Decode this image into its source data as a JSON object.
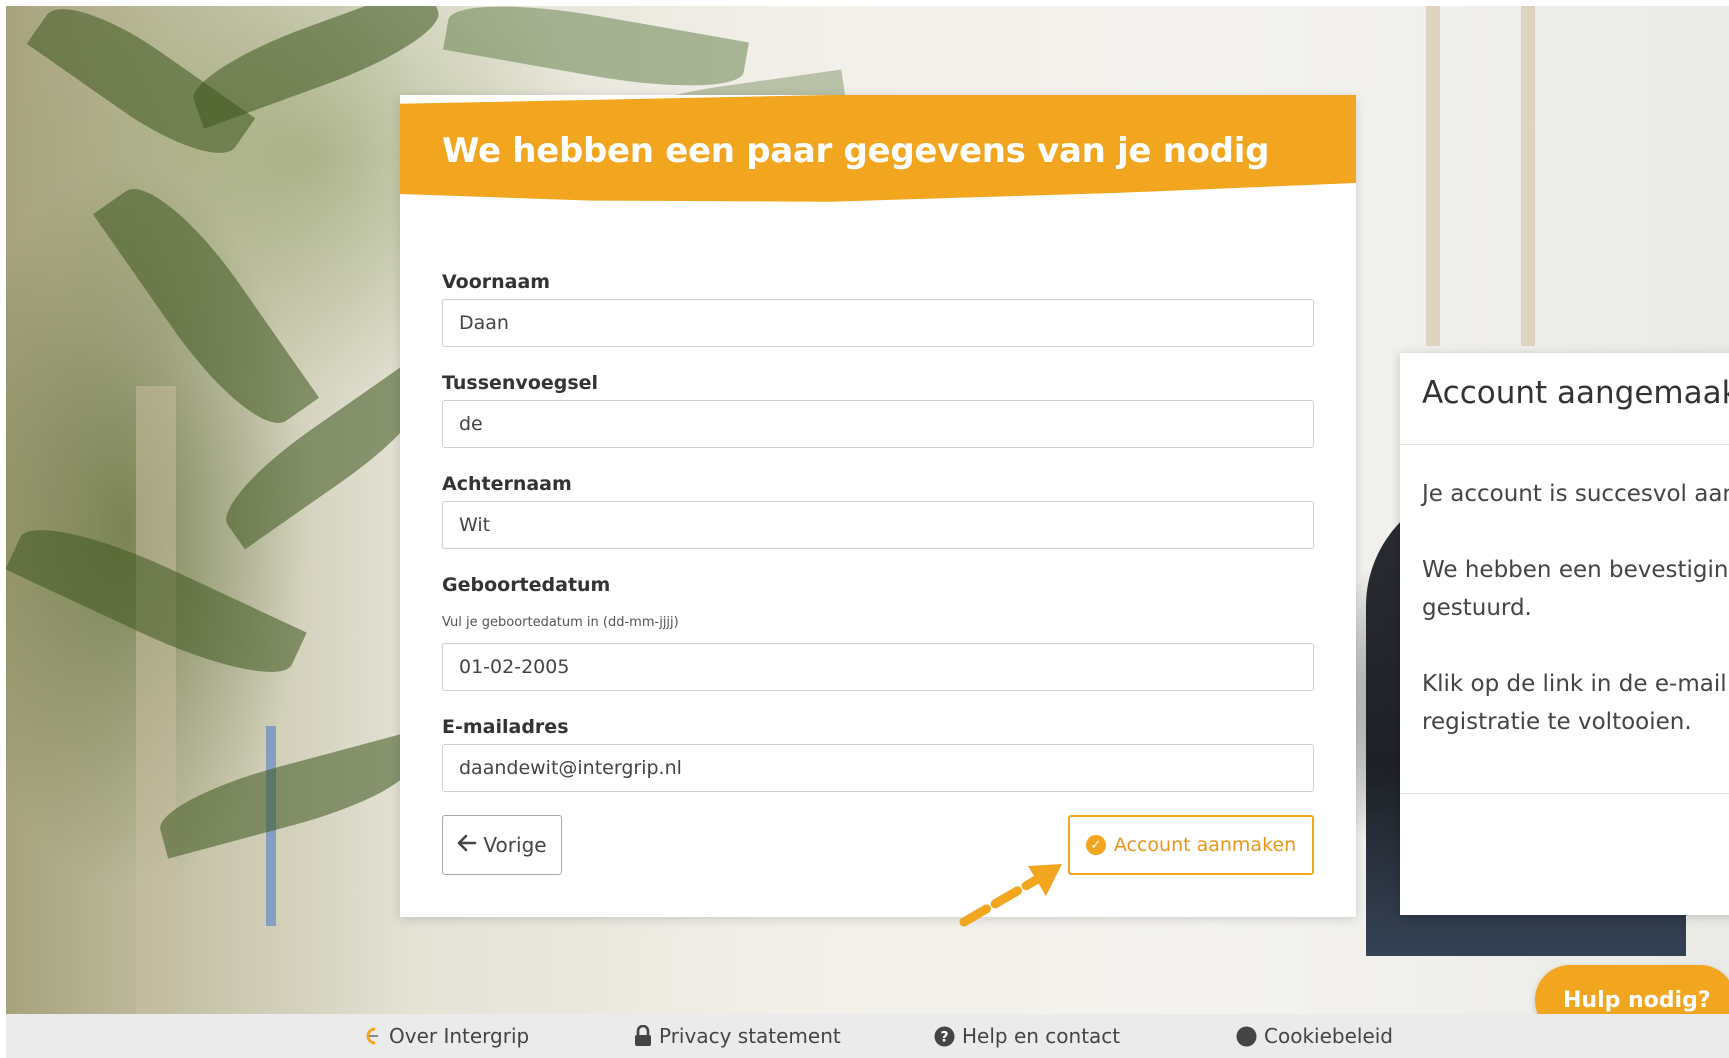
{
  "form": {
    "title": "We hebben een paar gegevens van je nodig",
    "fields": [
      {
        "label": "Voornaam",
        "value": "Daan"
      },
      {
        "label": "Tussenvoegsel",
        "value": "de"
      },
      {
        "label": "Achternaam",
        "value": "Wit"
      },
      {
        "label": "Geboortedatum",
        "hint": "Vul je geboortedatum in (dd-mm-jjjj)",
        "value": "01-02-2005"
      },
      {
        "label": "E-mailadres",
        "value": "daandewit@intergrip.nl"
      }
    ],
    "prev_button": "Vorige",
    "create_button": "Account aanmaken"
  },
  "modal": {
    "title": "Account aangemaakt",
    "line1": "Je account is succesvol aan",
    "line2a": "We hebben een bevestigin",
    "line2b": "gestuurd.",
    "line3a": "Klik op de link in de e-mail",
    "line3b": "registratie te voltooien."
  },
  "help_button": "Hulp nodig?",
  "footer": {
    "links": [
      {
        "label": "Over Intergrip",
        "icon": "intergrip-logo-icon"
      },
      {
        "label": "Privacy statement",
        "icon": "lock-icon"
      },
      {
        "label": "Help en contact",
        "icon": "question-circle-icon"
      },
      {
        "label": "Cookiebeleid",
        "icon": "circle-icon"
      }
    ]
  },
  "colors": {
    "accent": "#f2a51e",
    "footer_bg": "#ebebeb"
  }
}
